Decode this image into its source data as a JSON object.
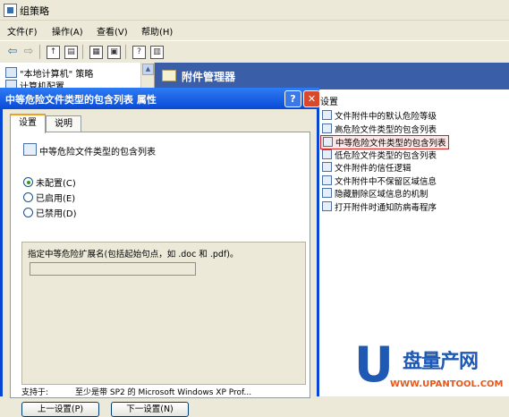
{
  "window": {
    "title": "组策略"
  },
  "menubar": [
    {
      "label": "文件(F)"
    },
    {
      "label": "操作(A)"
    },
    {
      "label": "查看(V)"
    },
    {
      "label": "帮助(H)"
    }
  ],
  "toolbar": {
    "icons": [
      "back-icon",
      "forward-icon",
      "up-folder-icon",
      "show-hide-tree-icon",
      "properties-icon",
      "export-icon",
      "help-icon",
      "console-icon"
    ]
  },
  "tree": {
    "items": [
      {
        "label": "\"本地计算机\" 策略"
      },
      {
        "label": "计算机配置"
      }
    ]
  },
  "right_pane": {
    "header": "附件管理器",
    "column": "设置",
    "items": [
      {
        "label": "文件附件中的默认危险等级"
      },
      {
        "label": "高危险文件类型的包含列表"
      },
      {
        "label": "中等危险文件类型的包含列表",
        "selected": true
      },
      {
        "label": "低危险文件类型的包含列表"
      },
      {
        "label": "文件附件的信任逻辑"
      },
      {
        "label": "文件附件中不保留区域信息"
      },
      {
        "label": "隐藏删除区域信息的机制"
      },
      {
        "label": "打开附件时通知防病毒程序"
      }
    ]
  },
  "dialog": {
    "title": "中等危险文件类型的包含列表 属性",
    "help_label": "?",
    "close_label": "✕",
    "tabs": [
      {
        "label": "设置"
      },
      {
        "label": "说明"
      }
    ],
    "policy_name": "中等危险文件类型的包含列表",
    "radios": [
      {
        "label": "未配置(C)",
        "checked": true
      },
      {
        "label": "已启用(E)",
        "checked": false
      },
      {
        "label": "已禁用(D)",
        "checked": false
      }
    ],
    "hint": "指定中等危险扩展名(包括起始句点，如 .doc 和 .pdf)。",
    "extension_value": "",
    "supported_label": "支持于:",
    "supported_value": "至少是带 SP2 的 Microsoft Windows XP Prof...",
    "prev_button": "上一设置(P)",
    "next_button": "下一设置(N)"
  },
  "watermark": {
    "logo_letter": "U",
    "brand": "盘量产网",
    "url": "WWW.UPANTOOL.COM"
  },
  "colors": {
    "header_blue": "#3a5ea8",
    "dialog_title": "#0a4ad6",
    "selection_border": "#d32020",
    "watermark_blue": "#1f59b3",
    "watermark_orange": "#e8581c"
  }
}
